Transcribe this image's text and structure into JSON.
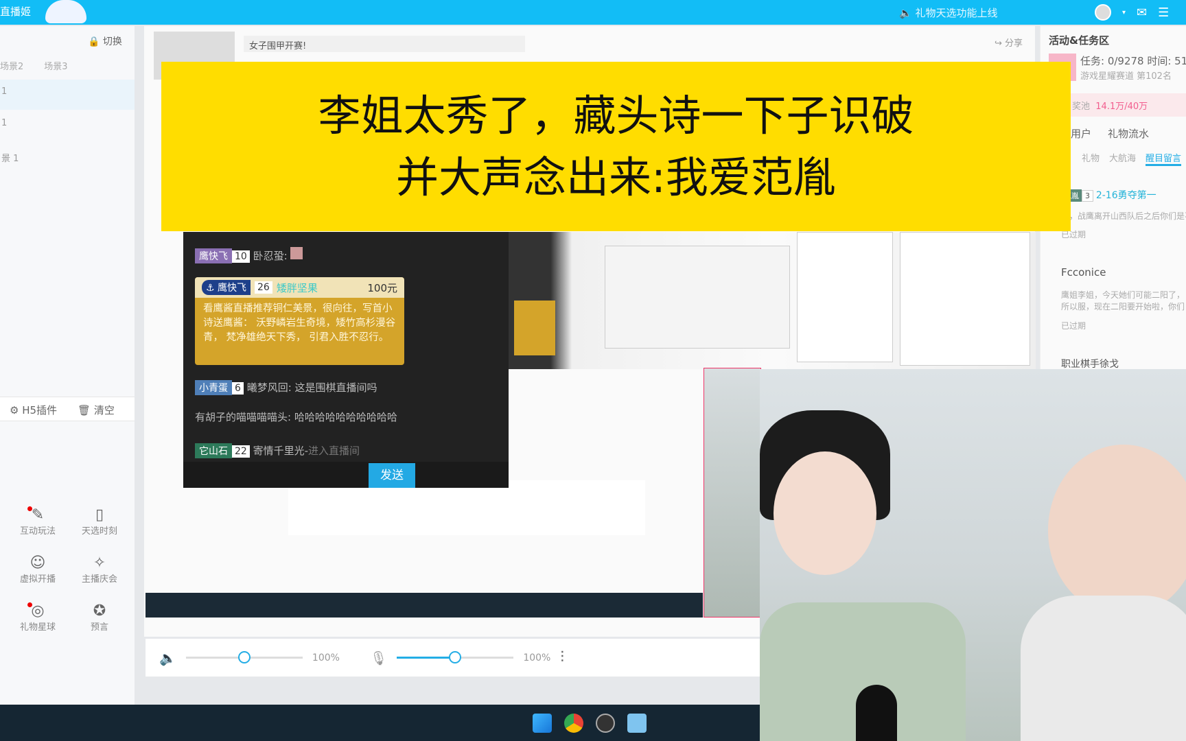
{
  "topbar": {
    "logo": "直播姬",
    "notice": "礼物天选功能上线",
    "icons": [
      "avatar",
      "caret-down-icon",
      "mail-icon",
      "menu-icon"
    ]
  },
  "sidebar": {
    "switch": "切换",
    "scenes": [
      "场景2",
      "场景3"
    ],
    "rows": [
      "1",
      "1",
      "景 1"
    ],
    "tools": {
      "h5": "H5插件",
      "clear": "清空"
    },
    "grid": [
      {
        "label": "互动玩法",
        "icon": "interactive-icon",
        "dot": true
      },
      {
        "label": "天选时刻",
        "icon": "lottery-card-icon",
        "dot": false
      },
      {
        "label": "虚拟开播",
        "icon": "virtual-avatar-icon",
        "dot": false
      },
      {
        "label": "主播庆会",
        "icon": "celebration-icon",
        "dot": false
      },
      {
        "label": "礼物星球",
        "icon": "planet-icon",
        "dot": true
      },
      {
        "label": "预言",
        "icon": "prophecy-icon",
        "dot": false
      }
    ]
  },
  "main": {
    "room_title": "女子围甲开赛!",
    "share": "分享"
  },
  "right": {
    "heading": "活动&任务区",
    "task": "任务: 0/9278 时间: 51:",
    "rank": "游戏星耀赛道 第102名",
    "pool_label": "奖池",
    "pool_value": "14.1万/40万",
    "tabs1": [
      "用户",
      "礼物流水"
    ],
    "tabs2": [
      "礼物",
      "大航海",
      "醒目留言"
    ],
    "active_tab": "醒目留言",
    "cards": [
      {
        "badge": "范胤",
        "level": "3",
        "title": "2-16勇夺第一",
        "body": "哦，战鹰离开山西队后之后你们是不",
        "status": "已过期"
      },
      {
        "title": "Fcconice",
        "body": "鹰姐李姐，今天她们可能二阳了，所以服，现在二阳要开始啦，你们也要注意",
        "status": "已过期"
      },
      {
        "title": "职业棋手徐戈"
      }
    ]
  },
  "caption": {
    "line1": "李姐太秀了，藏头诗一下子识破",
    "line2": "并大声念出来:我爱范胤"
  },
  "chat": {
    "messages": [
      {
        "badge": "鹰快飞",
        "level": "10",
        "text": "卧忍蛩:",
        "badge_color": "#8a6fb3"
      },
      {
        "badge": "小青蛋",
        "level": "6",
        "text": "曦梦风回: 这是围棋直播间吗",
        "badge_color": "#4f7fb8"
      },
      {
        "text": "有胡子的喵喵喵喵头: 哈哈哈哈哈哈哈哈哈哈"
      },
      {
        "badge": "它山石",
        "level": "22",
        "text": "寄情千里光-",
        "suffix": "进入直播间",
        "badge_color": "#2d7a5a"
      }
    ],
    "superchat": {
      "badge": "鹰快飞",
      "level": "26",
      "user": "矮胖坚果",
      "price": "100元",
      "text": "看鹰酱直播推荐铜仁美景，很向往，写首小诗送鹰酱： 沃野嶙岩生奇境，矮竹高杉漫谷青， 梵净雄绝天下秀， 引君入胜不忍行。"
    },
    "send": "发送"
  },
  "volume": {
    "speaker": "100%",
    "mic": "100%",
    "speaker_level": 0.5,
    "mic_level": 0.5
  },
  "taskbar": {
    "apps": [
      "windows-start-icon",
      "chrome-icon",
      "obs-icon",
      "livehime-icon"
    ]
  },
  "colors": {
    "accent": "#12bdf6",
    "caption_bg": "#ffdd00",
    "superchat": "#d4a42a"
  }
}
